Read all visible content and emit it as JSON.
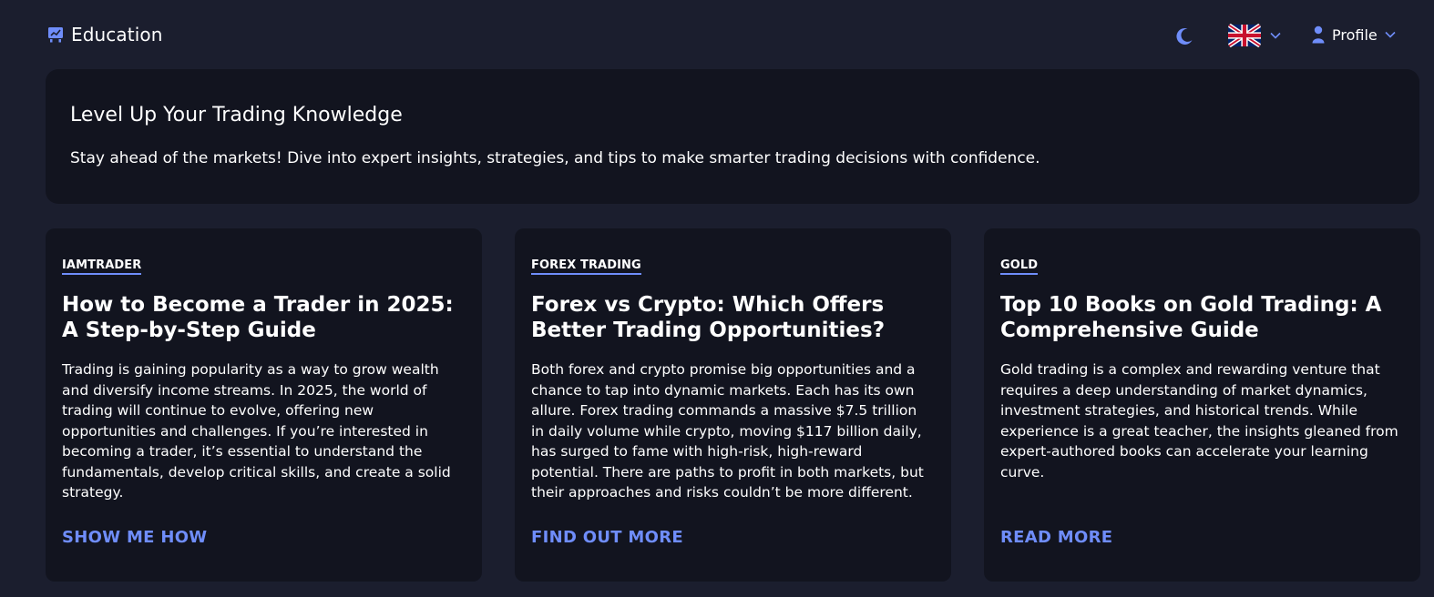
{
  "header": {
    "title": "Education",
    "brand_icon": "presentation-chart-icon",
    "theme_icon": "moon-icon",
    "language_flag": "uk-flag-icon",
    "profile_label": "Profile",
    "accent_color": "#6f8dfa"
  },
  "hero": {
    "title": "Level Up Your Trading Knowledge",
    "text": "Stay ahead of the markets! Dive into expert insights, strategies, and tips to make smarter trading decisions with confidence."
  },
  "cards": [
    {
      "tag": "IAMTRADER",
      "title": "How to Become a Trader in 2025: A Step-by-Step Guide",
      "excerpt": "Trading is gaining popularity as a way to grow wealth and diversify income streams. In 2025, the world of trading will continue to evolve, offering new opportunities and challenges. If you’re interested in becoming a trader, it’s essential to understand the fundamentals, develop critical skills, and create a solid strategy.",
      "cta": "SHOW ME HOW"
    },
    {
      "tag": "FOREX TRADING",
      "title": "Forex vs Crypto: Which Offers Better Trading Opportunities?",
      "excerpt": "Both forex and crypto promise big opportunities and a chance to tap into dynamic markets. Each has its own allure. Forex trading commands a massive $7.5 trillion in daily volume while crypto, moving $117 billion daily, has surged to fame with high-risk, high-reward potential. There are paths to profit in both markets, but their approaches and risks couldn’t be more different.",
      "cta": "FIND OUT MORE"
    },
    {
      "tag": "GOLD",
      "title": "Top 10 Books on Gold Trading: A Comprehensive Guide",
      "excerpt": "Gold trading is a complex and rewarding venture that requires a deep understanding of market dynamics, investment strategies, and historical trends. While experience is a great teacher, the insights gleaned from expert-authored books can accelerate your learning curve.",
      "cta": "READ MORE"
    }
  ]
}
